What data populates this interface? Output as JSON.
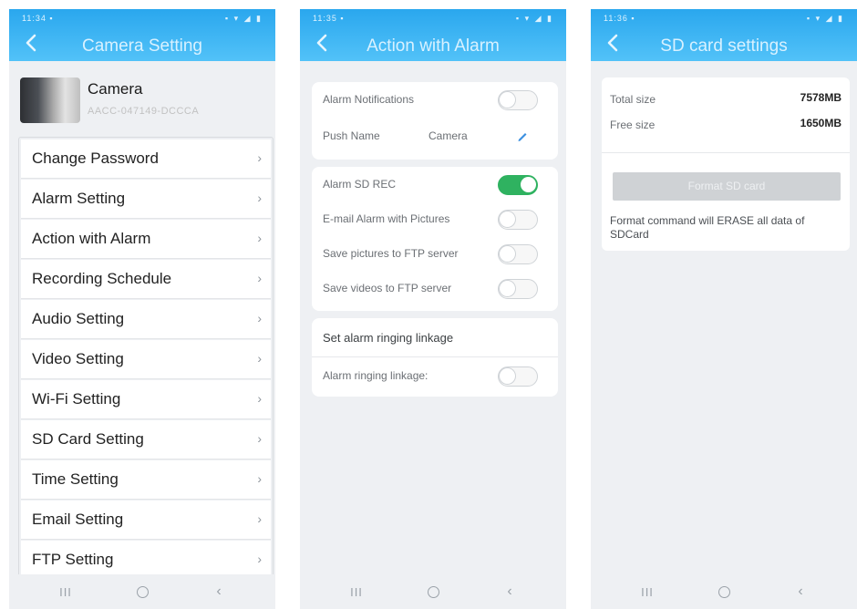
{
  "status_bar": {
    "icons": "▪ ▾ ◢ ▮"
  },
  "panel1": {
    "status_time": "11:34 ▪",
    "title": "Camera Setting",
    "camera": {
      "name": "Camera",
      "id": "AACC-047149-DCCCA"
    },
    "menu": [
      {
        "label": "Change Password"
      },
      {
        "label": "Alarm Setting"
      },
      {
        "label": "Action with Alarm"
      },
      {
        "label": "Recording Schedule"
      },
      {
        "label": "Audio Setting"
      },
      {
        "label": "Video Setting"
      },
      {
        "label": "Wi-Fi Setting"
      },
      {
        "label": "SD Card Setting"
      },
      {
        "label": "Time Setting"
      },
      {
        "label": "Email Setting"
      },
      {
        "label": "FTP Setting"
      }
    ],
    "chevron": "›"
  },
  "panel2": {
    "status_time": "11:35 ▪",
    "title": "Action with Alarm",
    "alarm_notifications": {
      "label": "Alarm Notifications",
      "on": false
    },
    "push_name": {
      "label": "Push Name",
      "value": "Camera"
    },
    "alarm_sd_rec": {
      "label": "Alarm SD REC",
      "on": true
    },
    "email_alarm": {
      "label": "E-mail Alarm with Pictures",
      "on": false
    },
    "ftp_pictures": {
      "label": "Save pictures to FTP server",
      "on": false
    },
    "ftp_videos": {
      "label": "Save videos to FTP server",
      "on": false
    },
    "ringing_section_title": "Set alarm ringing linkage",
    "ringing": {
      "label": "Alarm ringing linkage:",
      "on": false
    }
  },
  "panel3": {
    "status_time": "11:36 ▪",
    "title": "SD card settings",
    "total_label": "Total size",
    "total_value": "7578MB",
    "free_label": "Free size",
    "free_value": "1650MB",
    "format_button": "Format SD card",
    "note": "Format command will ERASE all data of SDCard"
  },
  "nav": {
    "recents": "III",
    "back": "‹"
  },
  "colors": {
    "header": "#2aa7ee",
    "toggle_on": "#2fb260",
    "background": "#eef0f3"
  }
}
